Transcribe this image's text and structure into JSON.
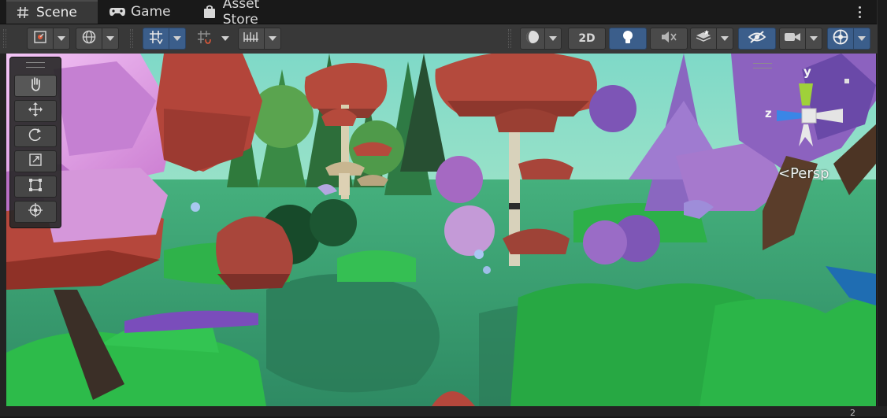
{
  "tabs": [
    {
      "label": "Scene",
      "icon": "scene-grid-icon",
      "active": true
    },
    {
      "label": "Game",
      "icon": "gamepad-icon",
      "active": false
    },
    {
      "label": "Asset Store",
      "icon": "store-bag-icon",
      "active": false
    }
  ],
  "toolbar": {
    "left_tools": [
      "gizmo-handle-position-icon",
      "global-local-icon",
      "grid-snap-icon",
      "increment-snap-icon",
      "ruler-snap-icon"
    ],
    "right_tools": [
      "draw-mode-sphere-icon",
      "2d-toggle",
      "lighting-bulb-icon",
      "audio-mute-icon",
      "effects-layers-icon",
      "visibility-eye-icon",
      "camera-icon",
      "gizmos-icon"
    ],
    "mode_2d_label": "2D"
  },
  "scene_tools": [
    "hand-tool-icon",
    "move-tool-icon",
    "rotate-tool-icon",
    "scale-tool-icon",
    "rect-tool-icon",
    "transform-tool-icon"
  ],
  "gizmo": {
    "y_label": "y",
    "z_label": "z",
    "projection_label": "Persp"
  },
  "colors": {
    "accent": "#3b5e8b",
    "ground": "#3e9f73",
    "grass": "#2bb548",
    "mushroom_red": "#b5473c",
    "foliage_purple": "#a576c6",
    "pink_tree": "#d58ad8"
  },
  "status": {
    "corner_number": "2"
  }
}
